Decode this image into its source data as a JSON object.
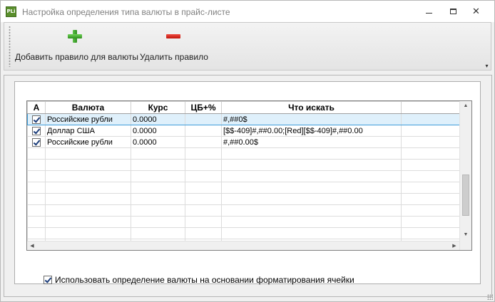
{
  "window": {
    "title": "Настройка определения типа валюты в прайс-листе",
    "app_icon_text": "PLi"
  },
  "toolbar": {
    "add_label": "Добавить правило для валюты",
    "delete_label": "Удалить правило"
  },
  "grid": {
    "columns": [
      "A",
      "Валюта",
      "Курс",
      "ЦБ+%",
      "Что искать",
      ""
    ],
    "rows": [
      {
        "checked": true,
        "currency": "Российские рубли",
        "rate": "0.0000",
        "cb": "",
        "pattern": "#,##0$",
        "selected": true
      },
      {
        "checked": true,
        "currency": "Доллар США",
        "rate": "0.0000",
        "cb": "",
        "pattern": "[$$-409]#,##0.00;[Red][$$-409]#,##0.00",
        "selected": false
      },
      {
        "checked": true,
        "currency": "Российские рубли",
        "rate": "0.0000",
        "cb": "",
        "pattern": "#,##0.00$",
        "selected": false
      }
    ],
    "empty_rows": 9
  },
  "option": {
    "checked": true,
    "label": "Использовать определение валюты на основании форматирования ячейки"
  },
  "colors": {
    "selection_fill": "#dff0fb",
    "selection_border": "#3b9cd9",
    "add_icon": "#2f8f1e",
    "delete_icon": "#c0160c"
  }
}
